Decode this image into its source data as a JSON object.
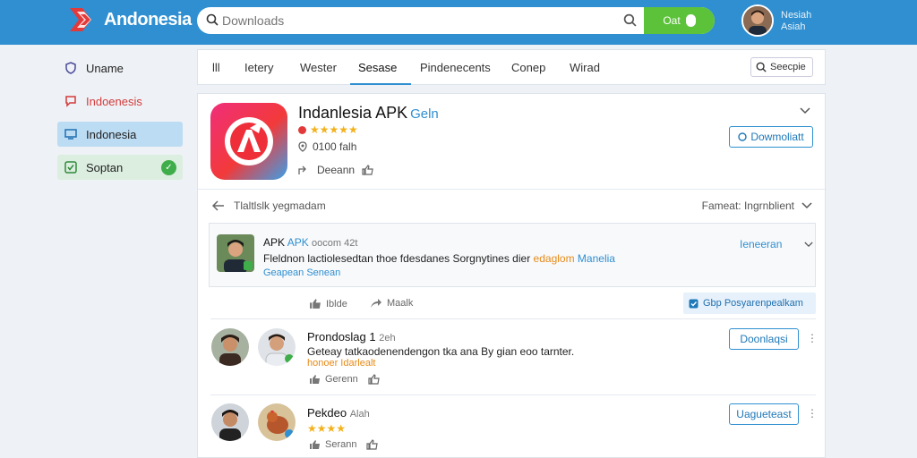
{
  "header": {
    "brand": "Andonesia",
    "search_placeholder": "Downloads",
    "search_button": "Oat",
    "user_name_line1": "Nesiah",
    "user_name_line2": "Asiah"
  },
  "sidebar": {
    "items": [
      {
        "label": "Uname",
        "icon": "shield-icon"
      },
      {
        "label": "Indoenesis",
        "icon": "chat-icon"
      },
      {
        "label": "Indonesia",
        "icon": "monitor-icon"
      },
      {
        "label": "Soptan",
        "icon": "check-icon",
        "badge": "✓"
      }
    ]
  },
  "tabs": {
    "items": [
      "lll",
      "Ietery",
      "Wester",
      "Sesase",
      "Pindenecents",
      "Conep",
      "Wirad"
    ],
    "active_index": 3,
    "search_label": "Seecpie"
  },
  "app": {
    "title": "Indanlesia APK",
    "subtitle": "Geln",
    "stars": "★★★★★",
    "meta": "0100 falh",
    "action": "Deeann",
    "download_label": "Dowmoliatt"
  },
  "section": {
    "left_label": "Tlaltlslk yegmadam",
    "right_label": "Fameat: Ingrnblient"
  },
  "featured_comment": {
    "title_a": "APK",
    "title_b": "APK",
    "title_c": "oocom 42t",
    "text_main": "Fleldnon lactiolesedtan thoe fdesdanes Sorgnytines dier",
    "text_orange": "edaglom",
    "text_blue": "Manelia",
    "link": "Geapean Senean",
    "action_label": "Ieneeran",
    "like_label": "Iblde",
    "share_label": "Maalk",
    "checkbox_label": "Gbp Posyarenpealkam"
  },
  "comments": [
    {
      "title": "Prondoslag 1",
      "time": "2eh",
      "text": "Geteay tatkaodenendengon tka ana By gian eoo tarnter.",
      "subtext": "honoer Idarlealt",
      "action_a": "Gerenn",
      "button": "Doonlaqsi"
    },
    {
      "title": "Pekdeo",
      "time": "Alah",
      "stars": "★★★★",
      "action_a": "Serann",
      "button": "Uagueteast"
    }
  ],
  "colors": {
    "topbar": "#2f8fd0",
    "accent_green": "#5cc23a",
    "link_blue": "#2f8fd0",
    "star": "#f3b11c",
    "orange": "#e88a17"
  }
}
